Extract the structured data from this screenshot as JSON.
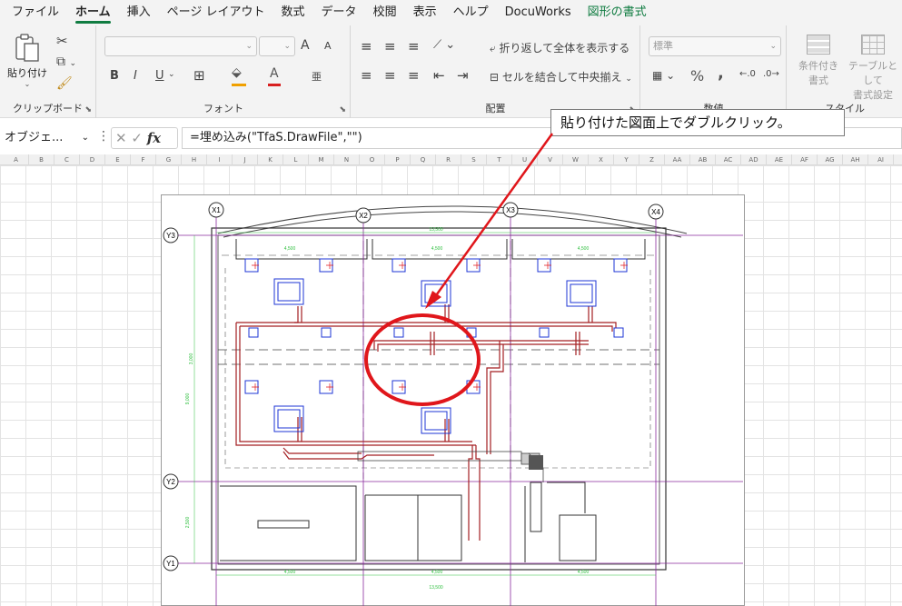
{
  "tabs": [
    {
      "label": "ファイル",
      "active": false
    },
    {
      "label": "ホーム",
      "active": true
    },
    {
      "label": "挿入",
      "active": false
    },
    {
      "label": "ページ レイアウト",
      "active": false
    },
    {
      "label": "数式",
      "active": false
    },
    {
      "label": "データ",
      "active": false
    },
    {
      "label": "校閲",
      "active": false
    },
    {
      "label": "表示",
      "active": false
    },
    {
      "label": "ヘルプ",
      "active": false
    },
    {
      "label": "DocuWorks",
      "active": false
    },
    {
      "label": "図形の書式",
      "active": false
    }
  ],
  "ribbon": {
    "clipboard": {
      "label": "クリップボード",
      "paste_label": "貼り付け"
    },
    "font": {
      "label": "フォント",
      "bold": "B",
      "italic": "I",
      "underline": "U",
      "grow": "A",
      "shrink": "A",
      "font_color": "A",
      "phonetic": "亜"
    },
    "alignment": {
      "label": "配置",
      "wrap_text": "折り返して全体を表示する",
      "merge_center": "セルを結合して中央揃え"
    },
    "number": {
      "label": "数値",
      "format": "標準",
      "percent": "%",
      "comma": ","
    },
    "styles": {
      "label": "スタイル",
      "conditional": "条件付き書式",
      "conditional_line1": "条件付き",
      "conditional_line2": "書式",
      "table": "テーブルとして書式設定",
      "table_line1": "テーブルとして",
      "table_line2": "書式設定"
    }
  },
  "formula_bar": {
    "name_box": "オブジェ...",
    "fx": "fx",
    "formula": "=埋め込み(\"TfaS.DrawFile\",\"\")"
  },
  "callout": {
    "text": "貼り付けた図面上でダブルクリック。"
  },
  "columns": [
    "A",
    "B",
    "C",
    "D",
    "E",
    "F",
    "G",
    "H",
    "I",
    "J",
    "K",
    "L",
    "M",
    "N",
    "O",
    "P",
    "Q",
    "R",
    "S",
    "T",
    "U",
    "V",
    "W",
    "X",
    "Y",
    "Z",
    "AA",
    "AB",
    "AC",
    "AD",
    "AE",
    "AF",
    "AG",
    "AH",
    "AI"
  ],
  "drawing": {
    "grid_labels": {
      "x1": "X1",
      "x2": "X2",
      "x3": "X3",
      "x4": "X4",
      "y1": "Y1",
      "y2": "Y2",
      "y3": "Y3"
    },
    "dims": {
      "top_total": "13,500",
      "top_a": "4,500",
      "top_b": "4,500",
      "top_c": "4,500",
      "bottom_total": "13,500",
      "bottom_a": "4,500",
      "bottom_b": "4,500",
      "bottom_c": "4,500",
      "left_1": "3,000",
      "left_2": "9,000",
      "left_3": "2,500"
    }
  },
  "colors": {
    "accent": "#107c41",
    "annotation_red": "#e0161b",
    "pipe_red": "#a41e22",
    "grid_purple": "#8a2a9c",
    "dim_green": "#2fbf3f",
    "unit_blue": "#1d34d6"
  }
}
